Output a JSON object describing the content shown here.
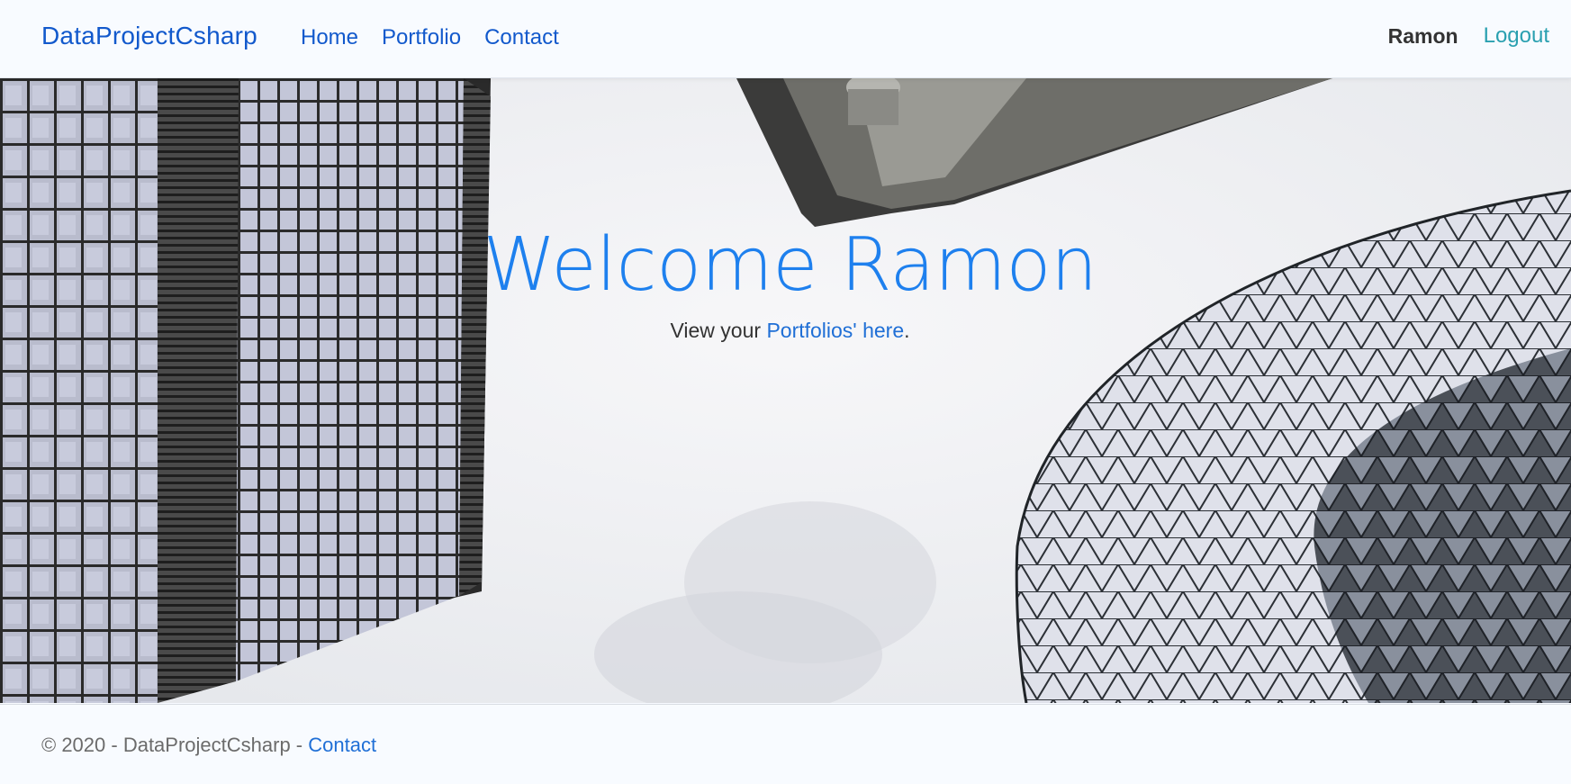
{
  "navbar": {
    "brand": "DataProjectCsharp",
    "links": [
      "Home",
      "Portfolio",
      "Contact"
    ],
    "user_name": "Ramon",
    "logout_label": "Logout"
  },
  "hero": {
    "title": "Welcome Ramon",
    "subtitle_prefix": "View your ",
    "subtitle_link": "Portfolios' here",
    "subtitle_suffix": "."
  },
  "footer": {
    "copyright": "© 2020 - DataProjectCsharp - ",
    "contact_link": "Contact"
  },
  "colors": {
    "brand": "#1259cc",
    "hero_title": "#1e80ee",
    "logout": "#2aa0b0"
  }
}
